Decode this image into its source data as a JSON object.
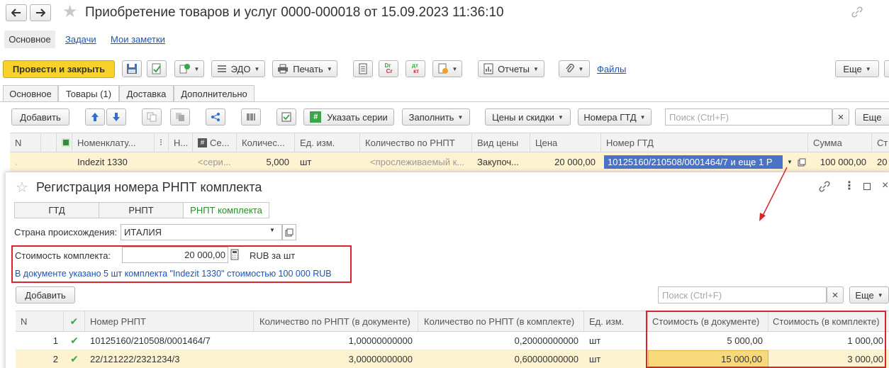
{
  "window": {
    "title": "Приобретение товаров и услуг 0000-000018 от 15.09.2023 11:36:10",
    "nav_tabs": [
      "Основное",
      "Задачи",
      "Мои заметки"
    ]
  },
  "toolbar": {
    "post_close": "Провести и закрыть",
    "edo": "ЭДО",
    "print": "Печать",
    "reports": "Отчеты",
    "files": "Файлы",
    "more": "Еще"
  },
  "doc_tabs": [
    "Основное",
    "Товары (1)",
    "Доставка",
    "Дополнительно"
  ],
  "goods_toolbar": {
    "add": "Добавить",
    "series": "Указать серии",
    "fill": "Заполнить",
    "prices": "Цены и скидки",
    "gtd_numbers": "Номера ГТД",
    "search_placeholder": "Поиск (Ctrl+F)",
    "clear": "×",
    "more": "Еще"
  },
  "goods_table": {
    "headers": [
      "N",
      "Номенклату...",
      "Н...",
      "Се...",
      "Количес...",
      "Ед. изм.",
      "Количество по РНПТ",
      "Вид цены",
      "Цена",
      "Номер ГТД",
      "Сумма",
      "Ст"
    ],
    "row": {
      "nomenclature": "Indezit 1330",
      "series": "<сери...",
      "qty": "5,000",
      "unit": "шт",
      "rnpt_qty": "<прослеживаемый к...",
      "price_type": "Закупоч...",
      "price": "20 000,00",
      "gtd": "10125160/210508/0001464/7 и еще 1 Р",
      "sum": "100 000,00",
      "st": "20"
    }
  },
  "dialog": {
    "title": "Регистрация номера РНПТ комплекта",
    "tabs": [
      "ГТД",
      "РНПТ",
      "РНПТ комплекта"
    ],
    "country_label": "Страна происхождения:",
    "country_value": "ИТАЛИЯ",
    "cost_label": "Стоимость комплекта:",
    "cost_value": "20 000,00",
    "cost_unit": "RUB за шт",
    "info": "В документе указано 5 шт комплекта \"Indezit 1330\" стоимостью 100 000 RUB",
    "add": "Добавить",
    "search_placeholder": "Поиск (Ctrl+F)",
    "clear": "×",
    "more": "Еще",
    "table": {
      "headers": [
        "N",
        "Номер РНПТ",
        "Количество по РНПТ (в документе)",
        "Количество по РНПТ (в комплекте)",
        "Ед. изм.",
        "Стоимость (в документе)",
        "Стоимость (в комплекте)"
      ],
      "rows": [
        {
          "n": "1",
          "rnpt": "10125160/210508/0001464/7",
          "qty_doc": "1,00000000000",
          "qty_kit": "0,20000000000",
          "unit": "шт",
          "cost_doc": "5 000,00",
          "cost_kit": "1 000,00"
        },
        {
          "n": "2",
          "rnpt": "22/121222/2321234/3",
          "qty_doc": "3,00000000000",
          "qty_kit": "0,60000000000",
          "unit": "шт",
          "cost_doc": "15 000,00",
          "cost_kit": "3 000,00"
        }
      ]
    }
  },
  "colors": {
    "accent_yellow": "#f8d22b",
    "selected_row": "#fdf3d0",
    "highlight_red": "#d9232d",
    "link_blue": "#1a55b8",
    "active_tab_green": "#2b8a2b"
  }
}
